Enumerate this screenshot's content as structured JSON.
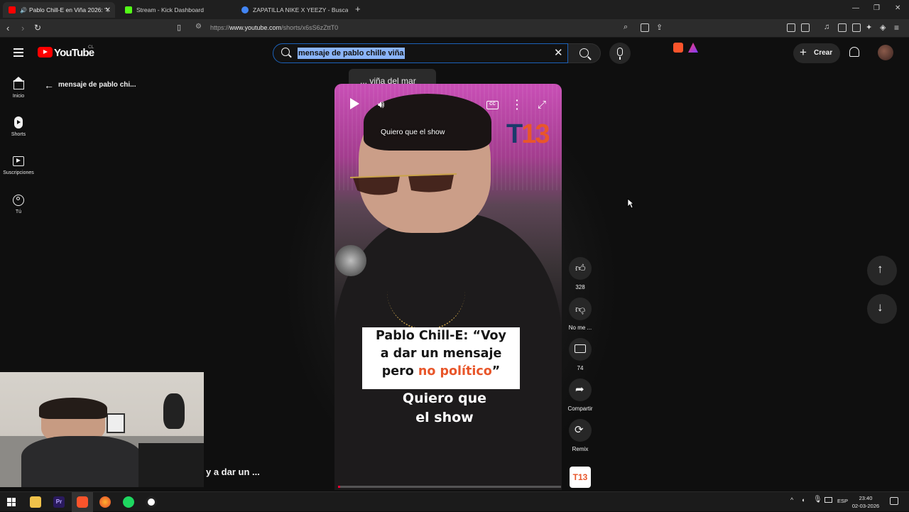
{
  "browser": {
    "tabs": [
      {
        "title": "Pablo Chill-E en Viña 2026: \"\\",
        "active": true,
        "favicon_color": "#ff0000"
      },
      {
        "title": "Stream - Kick Dashboard",
        "active": false,
        "favicon_color": "#53fc18"
      },
      {
        "title": "ZAPATILLA NIKE X YEEZY - Buscar co",
        "active": false,
        "favicon_color": "#4285f4"
      }
    ],
    "url_prefix": "https://",
    "url_host": "www.youtube.com",
    "url_path": "/shorts/x6sS6zZttT0"
  },
  "youtube": {
    "logo_text": "YouTube",
    "country": "CL",
    "search_query": "mensaje de pablo chille viña",
    "suggestion": "... viña del mar",
    "create_label": "Crear",
    "back_label": "mensaje de pablo chi...",
    "sidebar": [
      {
        "label": "Inicio",
        "icon": "home-icon"
      },
      {
        "label": "Shorts",
        "icon": "shorts-icon"
      },
      {
        "label": "Suscripciones",
        "icon": "subscriptions-icon"
      },
      {
        "label": "Tú",
        "icon": "you-icon"
      }
    ]
  },
  "video": {
    "caption_top": "Quiero que el show",
    "logo_t": "T",
    "logo_13": "13",
    "title_line1": "Pablo Chill-E: “Voy",
    "title_line2": "a dar un mensaje",
    "title_line3_plain": "pero ",
    "title_line3_orange": "no político",
    "title_line3_end": "”",
    "quote_line1": "Quiero que",
    "quote_line2": "el show",
    "progress_fraction": 0.01
  },
  "actions": {
    "likes": "328",
    "dislike_label": "No me ...",
    "comments": "74",
    "share_label": "Compartir",
    "remix_label": "Remix",
    "channel_badge": "T13"
  },
  "webcam_subtitle": "y a dar un ...",
  "taskbar": {
    "language": "ESP",
    "time": "23:40",
    "date": "02-03-2026"
  },
  "colors": {
    "youtube_red": "#ff0000",
    "search_focus": "#1c62b9",
    "t13_orange": "#e8562a"
  }
}
